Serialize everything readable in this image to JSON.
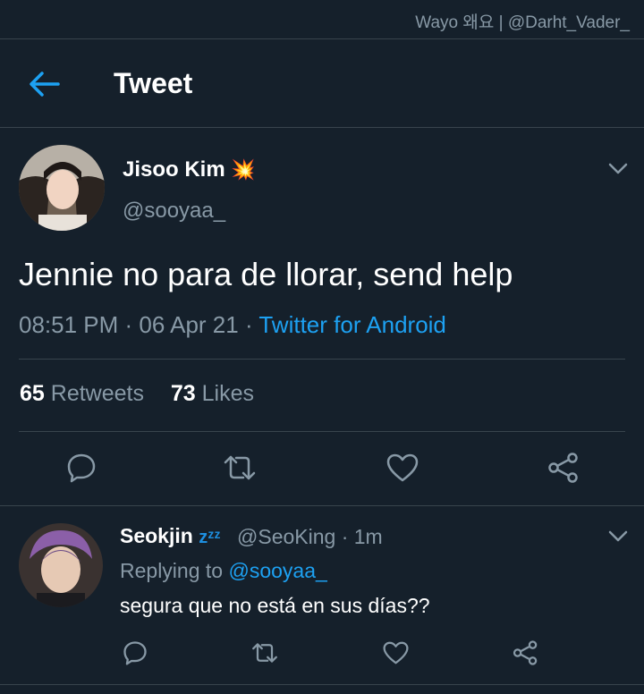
{
  "watermark": "Wayo 왜요 | @Darht_Vader_",
  "header": {
    "title": "Tweet"
  },
  "tweet": {
    "author_name": "Jisoo Kim",
    "author_emoji": "💥",
    "author_handle": "@sooyaa_",
    "text": "Jennie no para de llorar, send help",
    "time": "08:51 PM",
    "sep1": " · ",
    "date": "06 Apr 21",
    "sep2": " · ",
    "source": "Twitter for Android",
    "retweets_count": "65",
    "retweets_label": "Retweets",
    "likes_count": "73",
    "likes_label": "Likes"
  },
  "reply": {
    "author_name": "Seokjin",
    "author_emoji": "zᶻᶻ",
    "author_handle": "@SeoKing",
    "age": " · 1m",
    "replying_prefix": "Replying to ",
    "replying_handle": "@sooyaa_",
    "text": "segura que no está en sus días??"
  },
  "icons": [
    "back-arrow-icon",
    "chevron-down-icon",
    "reply-icon",
    "retweet-icon",
    "like-icon",
    "share-icon"
  ],
  "colors": {
    "background": "#15202b",
    "accent": "#1da1f2",
    "muted": "#8899a6",
    "divider": "#38444d"
  }
}
